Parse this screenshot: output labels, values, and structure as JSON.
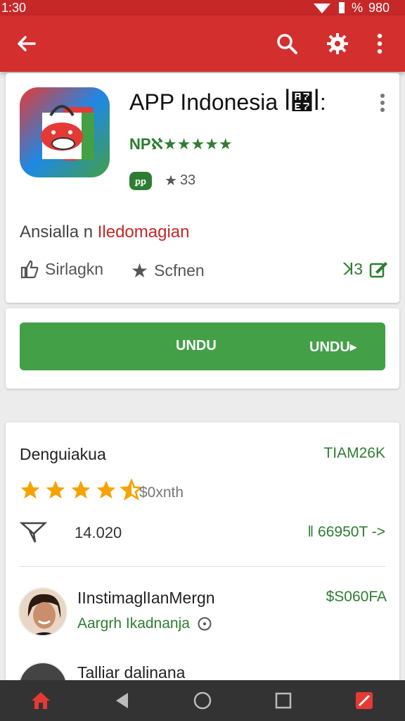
{
  "status_bar": {
    "time": "1:30",
    "battery": "%",
    "signal_text": "980"
  },
  "app_bar": {
    "icons": [
      "back-arrow-icon",
      "search-icon",
      "settings-gear-icon",
      "overflow-menu-icon"
    ]
  },
  "app": {
    "title": "APP Indonesia ꟾ꟧ꟾ:",
    "rating_text": "NPℵ★★★★★",
    "badge": "ᵱᵱ",
    "download_count": "33",
    "description_prefix": "Ansialla n ",
    "description_accent": "Iledomagian",
    "actions": {
      "left": "Sirlagkn",
      "middle": "Scfnen",
      "right": "ꓘ3"
    }
  },
  "install": {
    "left_label": "UNDU",
    "right_label": "UNDU▸"
  },
  "stats": {
    "title": "Denguiakua",
    "right_value": "TIAM26K",
    "stars_filled": 4.5,
    "stars_caption": "$0xnth",
    "count": "14.020",
    "link": "ǁ 66950T ->"
  },
  "reviews": [
    {
      "name": "IInstimaglIanMergn",
      "meta": "Aargrh Ikadnanja",
      "price": "$S060FA"
    },
    {
      "name": "Talliar dalinana",
      "meta": "",
      "price": ""
    }
  ],
  "colors": {
    "accent_red": "#d32f2f",
    "accent_green": "#43a047",
    "star_orange": "#f4a300"
  }
}
